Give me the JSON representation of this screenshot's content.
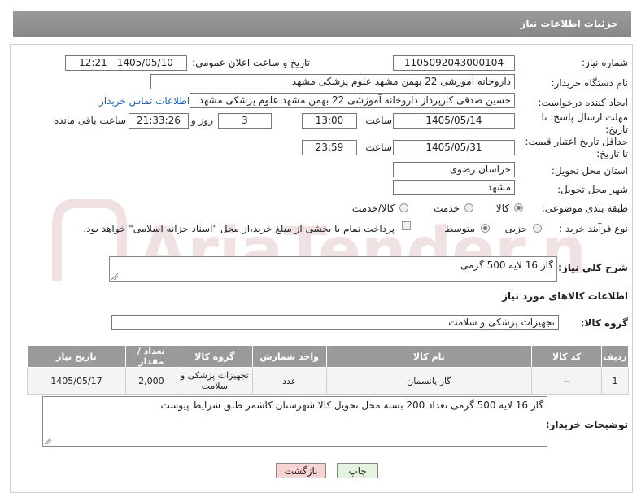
{
  "page": {
    "title": "جزئیات اطلاعات نیاز"
  },
  "fields": {
    "need_number_label": "شماره نیاز:",
    "need_number": "1105092043000104",
    "announce_label": "تاریخ و ساعت اعلان عمومی:",
    "announce_value": "1405/05/10 - 12:21",
    "buyer_org_label": "نام دستگاه خریدار:",
    "buyer_org": "داروخانه آموزشی 22 بهمن مشهد   علوم پزشکی مشهد",
    "creator_label": "ایجاد کننده درخواست:",
    "creator": "حسین صدقی کارپرداز داروخانه آموزشی 22 بهمن مشهد   علوم پزشکی مشهد",
    "contact_link": "اطلاعات تماس خریدار",
    "reply_deadline_label_1": "مهلت ارسال پاسخ: تا",
    "reply_deadline_label_2": "تاریخ:",
    "reply_date": "1405/05/14",
    "time_label": "ساعت",
    "reply_time": "13:00",
    "days_value": "3",
    "days_label": "روز و",
    "remaining_value": "21:33:26",
    "remaining_label": "ساعت باقی مانده",
    "price_valid_label_1": "حداقل تاریخ اعتبار قیمت:",
    "price_valid_label_2": "تا تاریخ:",
    "price_valid_date": "1405/05/31",
    "price_valid_time": "23:59",
    "province_label": "استان محل تحویل:",
    "province": "خراسان رضوی",
    "city_label": "شهر محل تحویل:",
    "city": "مشهد",
    "category_label": "طبقه بندی موضوعی:",
    "category_options": [
      "کالا",
      "خدمت",
      "کالا/خدمت"
    ],
    "category_selected": "کالا",
    "process_label": "نوع فرآیند خرید :",
    "process_options": [
      "جزیی",
      "متوسط"
    ],
    "process_selected": "متوسط",
    "payment_note": "پرداخت تمام یا بخشی از مبلغ خرید،از محل \"اسناد خزانه اسلامی\" خواهد بود."
  },
  "summary": {
    "label": "شرح کلی نیاز:",
    "value": "گاز 16 لایه 500 گرمی"
  },
  "goods": {
    "section_title": "اطلاعات کالاهای مورد نیاز",
    "group_label": "گروه کالا:",
    "group_value": "تجهیزات پزشکی و سلامت"
  },
  "table": {
    "headers": [
      "ردیف",
      "کد کالا",
      "نام کالا",
      "واحد شمارش",
      "گروه کالا",
      "تعداد / مقدار",
      "تاریخ نیاز"
    ],
    "rows": [
      [
        "1",
        "--",
        "گاز پانسمان",
        "عدد",
        "تجهیزات پزشکی و سلامت",
        "2,000",
        "1405/05/17"
      ]
    ]
  },
  "buyer_notes": {
    "label": "توضیحات خریدار:",
    "value": "گاز 16 لایه 500 گرمی تعداد 200 بسته محل تحویل کالا شهرستان کاشمر طبق شرایط پیوست"
  },
  "buttons": {
    "print": "چاپ",
    "back": "بازگشت"
  },
  "watermark": {
    "text": "AriaTender.net"
  },
  "colors": {
    "header_bar": "#8f8f8f",
    "link": "#1a5fb4",
    "back_button_bg": "#f7d4d4",
    "print_button_bg": "#e4f3df"
  }
}
